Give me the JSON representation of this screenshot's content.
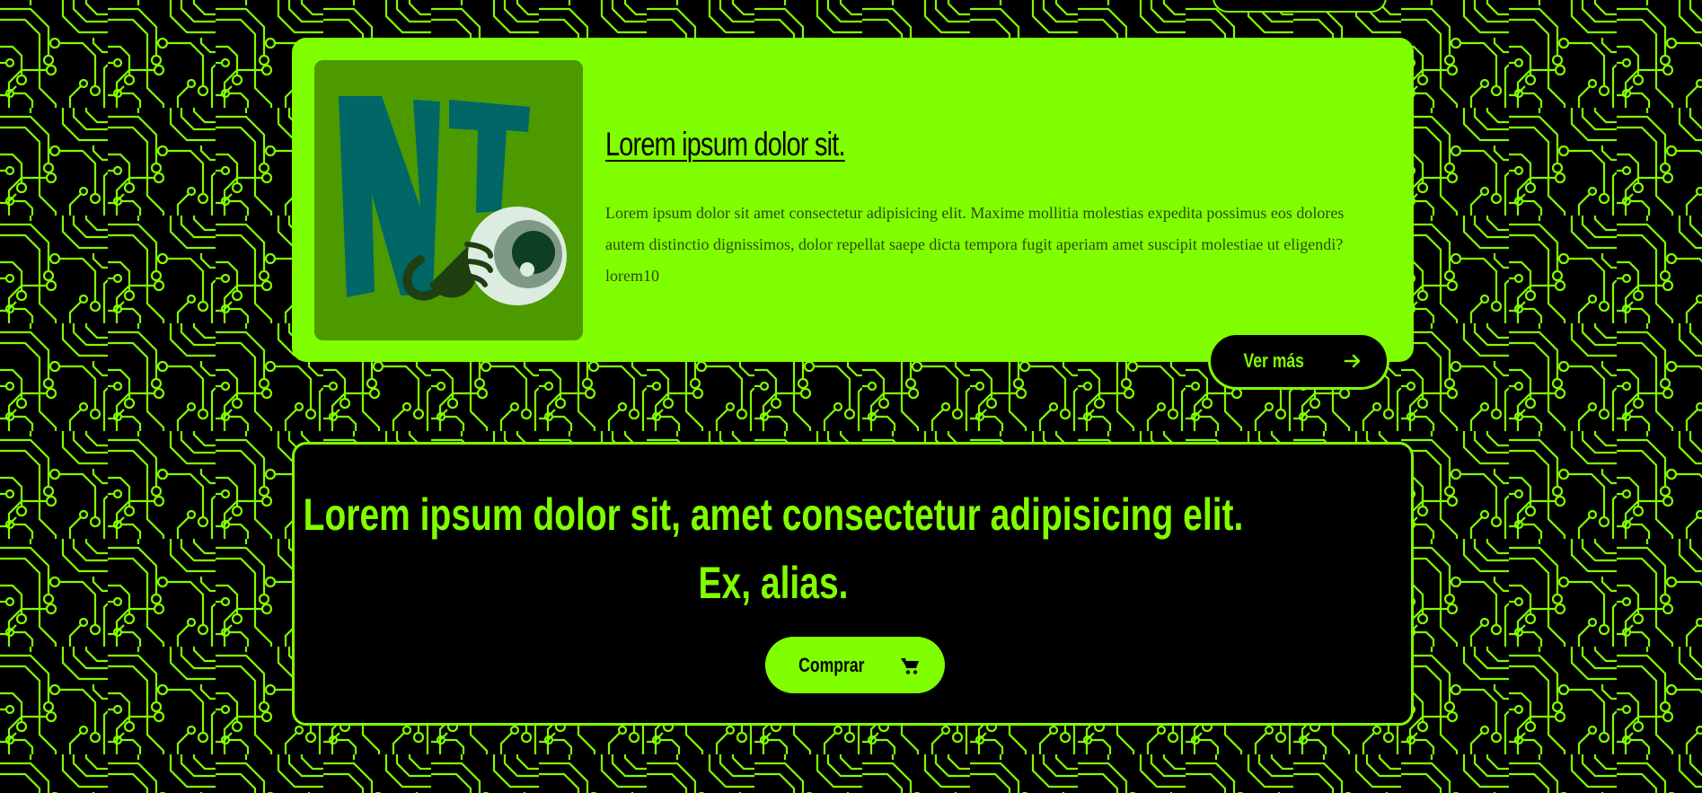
{
  "colors": {
    "accent": "#80ff00",
    "background": "#000000",
    "image_bg": "#4c9a00",
    "logo_teal": "#006666",
    "logo_dark": "#1f3f10"
  },
  "featured_card": {
    "logo_icon": "nt-eye-logo",
    "title": "Lorem ipsum dolor sit.",
    "description": "Lorem ipsum dolor sit amet consectetur adipisicing elit. Maxime mollitia molestias expedita possimus eos dolores autem distinctio dignissimos, dolor repellat saepe dicta tempora fugit aperiam amet suscipit molestiae ut eligendi?lorem10",
    "button_label": "Ver más",
    "button_icon": "arrow-right-icon"
  },
  "promo": {
    "heading": "Lorem ipsum dolor sit, amet consectetur adipisicing elit. Ex, alias.",
    "button_label": "Comprar",
    "button_icon": "cart-icon"
  }
}
